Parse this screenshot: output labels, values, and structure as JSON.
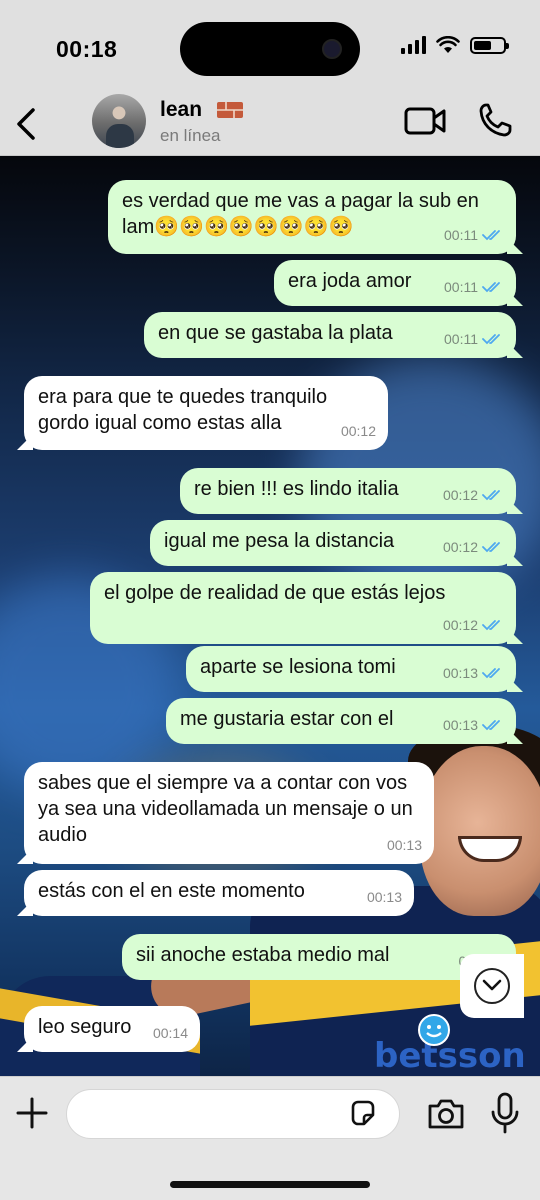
{
  "status_bar": {
    "time": "00:18"
  },
  "header": {
    "back_icon": "chevron-left-icon",
    "name": "lean",
    "name_emoji": "brick-emoji",
    "status": "en línea"
  },
  "messages": [
    {
      "dir": "out",
      "text": "es verdad que me vas a pagar la sub en lam🥺🥺🥺🥺🥺🥺🥺🥺",
      "time": "00:11",
      "read": true
    },
    {
      "dir": "out",
      "text": "era joda amor",
      "time": "00:11",
      "read": true
    },
    {
      "dir": "out",
      "text": "en que se gastaba la plata",
      "time": "00:11",
      "read": true
    },
    {
      "dir": "in",
      "text": "era para que te quedes tranquilo gordo igual como estas alla",
      "time": "00:12"
    },
    {
      "dir": "out",
      "text": "re bien !!! es lindo italia",
      "time": "00:12",
      "read": true
    },
    {
      "dir": "out",
      "text": "igual me pesa la distancia",
      "time": "00:12",
      "read": true
    },
    {
      "dir": "out",
      "text": "el golpe de realidad de que estás lejos",
      "time": "00:12",
      "read": true
    },
    {
      "dir": "out",
      "text": "aparte se lesiona tomi",
      "time": "00:13",
      "read": true
    },
    {
      "dir": "out",
      "text": "me gustaria estar con el",
      "time": "00:13",
      "read": true
    },
    {
      "dir": "in",
      "text": "sabes que el siempre va a contar con vos ya sea una videollamada un mensaje o un audio",
      "time": "00:13"
    },
    {
      "dir": "in",
      "text": "estás con el en este momento",
      "time": "00:13"
    },
    {
      "dir": "out",
      "text": "sii anoche estaba medio mal",
      "time": "00:",
      "read": true
    },
    {
      "dir": "in",
      "text": "leo seguro",
      "time": "00:14"
    }
  ],
  "background_text": {
    "sponsor": "betsson"
  },
  "composer": {
    "placeholder": ""
  },
  "colors": {
    "outgoing": "#d9fdd3",
    "incoming": "#ffffff",
    "tick": "#4ea8f0"
  }
}
